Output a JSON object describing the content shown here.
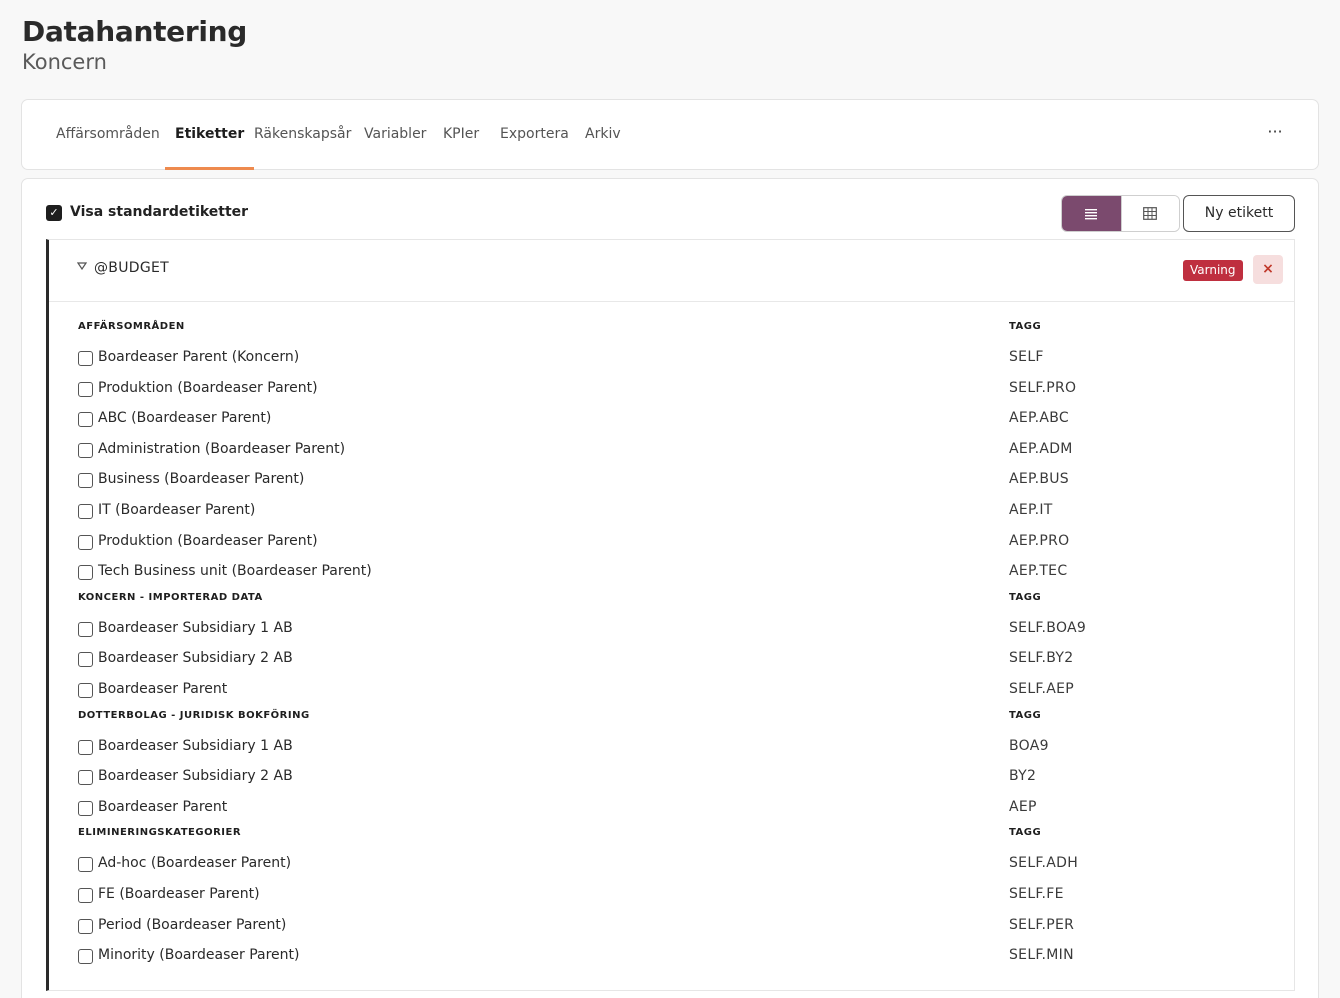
{
  "header": {
    "title": "Datahantering",
    "subtitle": "Koncern"
  },
  "tabs": [
    {
      "label": "Affärsområden",
      "active": false
    },
    {
      "label": "Etiketter",
      "active": true
    },
    {
      "label": "Räkenskapsår",
      "active": false
    },
    {
      "label": "Variabler",
      "active": false
    },
    {
      "label": "KPIer",
      "active": false
    },
    {
      "label": "Exportera",
      "active": false
    },
    {
      "label": "Arkiv",
      "active": false
    }
  ],
  "more_icon": "···",
  "toolbar": {
    "show_standard_label": "Visa standardetiketter",
    "show_standard_checked": true,
    "view_mode": "list",
    "new_label_button": "Ny etikett"
  },
  "section": {
    "name": "@BUDGET",
    "badge": "Varning",
    "collapse_icon": "caret-down",
    "close_icon": "×"
  },
  "groups": [
    {
      "header": "AFFÄRSOMRÅDEN",
      "tag_header": "TAGG",
      "rows": [
        {
          "label": "Boardeaser Parent (Koncern)",
          "tag": "SELF"
        },
        {
          "label": "Produktion (Boardeaser Parent)",
          "tag": "SELF.PRO"
        },
        {
          "label": "ABC (Boardeaser Parent)",
          "tag": "AEP.ABC"
        },
        {
          "label": "Administration (Boardeaser Parent)",
          "tag": "AEP.ADM"
        },
        {
          "label": "Business (Boardeaser Parent)",
          "tag": "AEP.BUS"
        },
        {
          "label": "IT (Boardeaser Parent)",
          "tag": "AEP.IT"
        },
        {
          "label": "Produktion (Boardeaser Parent)",
          "tag": "AEP.PRO"
        },
        {
          "label": "Tech Business unit (Boardeaser Parent)",
          "tag": "AEP.TEC"
        }
      ]
    },
    {
      "header": "KONCERN - IMPORTERAD DATA",
      "tag_header": "TAGG",
      "rows": [
        {
          "label": "Boardeaser Subsidiary 1 AB",
          "tag": "SELF.BOA9"
        },
        {
          "label": "Boardeaser Subsidiary 2 AB",
          "tag": "SELF.BY2"
        },
        {
          "label": "Boardeaser Parent",
          "tag": "SELF.AEP"
        }
      ]
    },
    {
      "header": "DOTTERBOLAG - JURIDISK BOKFÖRING",
      "tag_header": "TAGG",
      "rows": [
        {
          "label": "Boardeaser Subsidiary 1 AB",
          "tag": "BOA9"
        },
        {
          "label": "Boardeaser Subsidiary 2 AB",
          "tag": "BY2"
        },
        {
          "label": "Boardeaser Parent",
          "tag": "AEP"
        }
      ]
    },
    {
      "header": "ELIMINERINGSKATEGORIER",
      "tag_header": "TAGG",
      "rows": [
        {
          "label": "Ad-hoc (Boardeaser Parent)",
          "tag": "SELF.ADH"
        },
        {
          "label": "FE (Boardeaser Parent)",
          "tag": "SELF.FE"
        },
        {
          "label": "Period (Boardeaser Parent)",
          "tag": "SELF.PER"
        },
        {
          "label": "Minority (Boardeaser Parent)",
          "tag": "SELF.MIN"
        }
      ]
    }
  ],
  "colors": {
    "accent_tab": "#ee8a4e",
    "toggle_active": "#7b4a6e",
    "badge": "#bf2f3f",
    "close_bg": "#f6dede"
  }
}
